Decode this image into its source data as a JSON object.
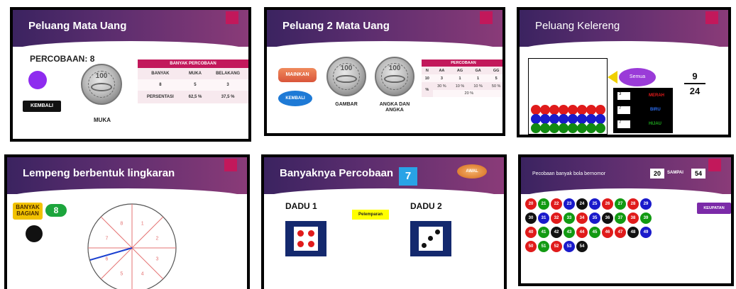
{
  "panel1": {
    "title": "Peluang Mata Uang",
    "trial_label": "PERCOBAAN:",
    "trial_value": "8",
    "back_label": "KEMBALI",
    "coin_text": "100",
    "coin_caption": "MUKA",
    "circle_color": "#8e2bef",
    "table": {
      "head": "BANYAK PERCOBAAN",
      "cols": [
        "BANYAK",
        "MUKA",
        "BELAKANG"
      ],
      "counts": [
        "8",
        "5",
        "3"
      ],
      "pct_label": "PERSENTASI",
      "pcts": [
        "62,5 %",
        "37,5 %"
      ]
    }
  },
  "panel2": {
    "title": "Peluang 2 Mata Uang",
    "play_label": "MAINKAN",
    "back_label": "KEMBALI",
    "coin_text": "100",
    "coin1_caption": "GAMBAR",
    "coin2_caption": "ANGKA DAN ANGKA",
    "table": {
      "head": "PERCOBAAN",
      "cols": [
        "N",
        "AA",
        "AG",
        "GA",
        "GG"
      ],
      "counts": [
        "10",
        "3",
        "1",
        "1",
        "5"
      ],
      "pct_label": "%",
      "pcts": [
        "30 %",
        "10 %",
        "10 %",
        "50 %"
      ],
      "extra": "20 %"
    }
  },
  "panel3": {
    "title": "Peluang Kelereng",
    "bubble_label": "Semua",
    "labels": [
      "MERAH",
      "BIRU",
      "HIJAU"
    ],
    "inputs": [
      "3",
      "7",
      "7"
    ],
    "fraction_num": "9",
    "fraction_den": "24",
    "colors": {
      "red": "#e01b1b",
      "blue": "#1a1acb",
      "green": "#118a11"
    }
  },
  "panel4": {
    "title": "Lempeng berbentuk lingkaran",
    "label": "BANYAK BAGIAN",
    "value": "8",
    "sector_numbers": [
      "1",
      "2",
      "3",
      "4",
      "5",
      "6",
      "7",
      "8"
    ]
  },
  "panel5": {
    "title": "Banyaknya Percobaan",
    "count": "7",
    "start_label": "AWAL",
    "dice1_label": "DADU 1",
    "dice2_label": "DADU 2",
    "throw_label": "Pelemparan"
  },
  "panel6": {
    "title": "Pecobaan banyak bola bernomor",
    "range_from": "20",
    "range_word": "SAMPAI",
    "range_to": "54",
    "button_label": "KEUPATAN",
    "balls": [
      [
        "20",
        "red"
      ],
      [
        "21",
        "green"
      ],
      [
        "22",
        "red"
      ],
      [
        "23",
        "blue"
      ],
      [
        "24",
        "black"
      ],
      [
        "25",
        "blue"
      ],
      [
        "26",
        "red"
      ],
      [
        "27",
        "green"
      ],
      [
        "28",
        "red"
      ],
      [
        "29",
        "blue"
      ],
      [
        "30",
        "black"
      ],
      [
        "31",
        "blue"
      ],
      [
        "32",
        "red"
      ],
      [
        "33",
        "green"
      ],
      [
        "34",
        "red"
      ],
      [
        "35",
        "blue"
      ],
      [
        "36",
        "black"
      ],
      [
        "37",
        "green"
      ],
      [
        "38",
        "red"
      ],
      [
        "39",
        "green"
      ],
      [
        "40",
        "red"
      ],
      [
        "41",
        "green"
      ],
      [
        "42",
        "black"
      ],
      [
        "43",
        "green"
      ],
      [
        "44",
        "red"
      ],
      [
        "45",
        "green"
      ],
      [
        "46",
        "red"
      ],
      [
        "47",
        "red"
      ],
      [
        "48",
        "black"
      ],
      [
        "49",
        "blue"
      ],
      [
        "50",
        "red"
      ],
      [
        "51",
        "green"
      ],
      [
        "52",
        "red"
      ],
      [
        "53",
        "blue"
      ],
      [
        "54",
        "black"
      ]
    ]
  }
}
